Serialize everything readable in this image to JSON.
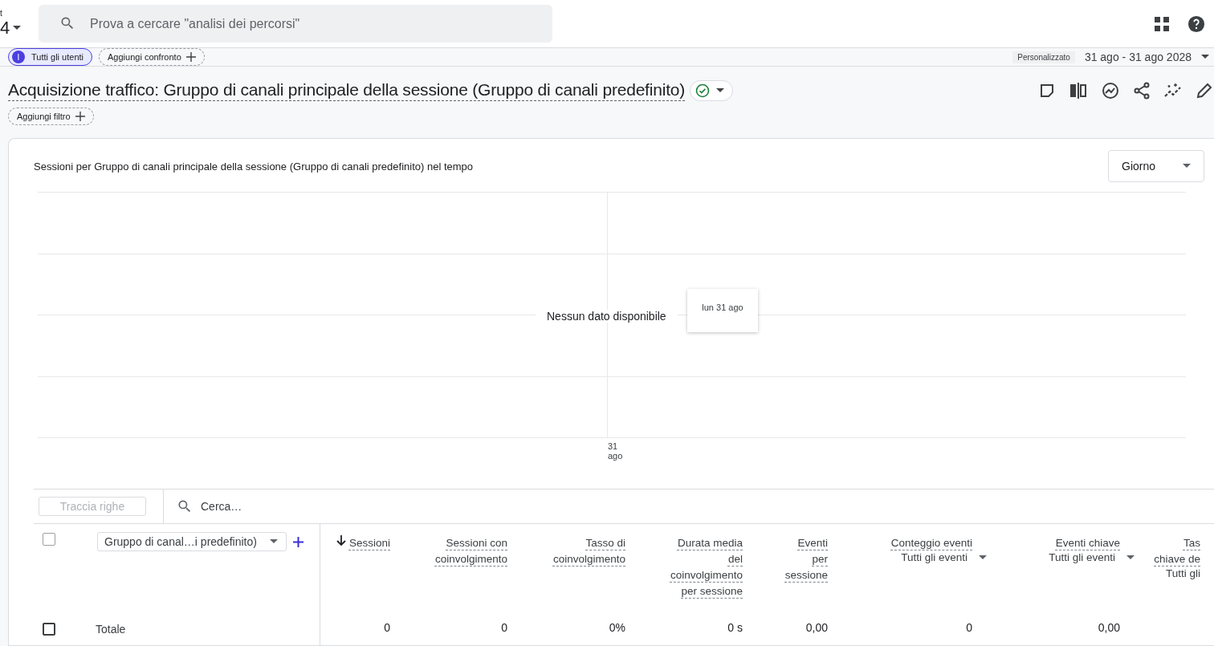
{
  "header": {
    "property_fragment": "t",
    "property_value": "4",
    "search": {
      "placeholder": "Prova a cercare \"analisi dei percorsi\""
    }
  },
  "comparisons": {
    "segment": {
      "letter": "I",
      "label": "Tutti gli utenti",
      "selected": true
    },
    "add_button": "Aggiungi confronto",
    "date_kind": "Personalizzato",
    "date_range": "31 ago - 31 ago 2028"
  },
  "report": {
    "title": "Acquisizione traffico: Gruppo di canali principale della sessione (Gruppo di canali predefinito)",
    "status_ok": true,
    "add_filter": "Aggiungi filtro"
  },
  "chart": {
    "title": "Sessioni per Gruppo di canali principale della sessione (Gruppo di canali predefinito) nel tempo",
    "granularity": "Giorno",
    "empty_message": "Nessun dato disponibile",
    "tooltip": "lun 31 ago",
    "x_label_day": "31",
    "x_label_month": "ago"
  },
  "table": {
    "plot_rows_button": "Traccia righe",
    "search": {
      "placeholder": "Cerca…"
    },
    "select_all_checked": false,
    "dimension": "Gruppo di canal…i predefinito)",
    "columns": [
      {
        "label": "Sessioni",
        "sorted": true
      },
      {
        "label": "Sessioni con coinvolgimento",
        "sorted": false
      },
      {
        "label": "Tasso di coinvolgimento",
        "sorted": false
      },
      {
        "label": "Durata media del coinvolgimento per sessione",
        "sorted": false
      },
      {
        "label": "Eventi per sessione",
        "sorted": false
      },
      {
        "label": "Conteggio eventi",
        "sorted": false,
        "filter": "Tutti gli eventi"
      },
      {
        "label": "Eventi chiave",
        "sorted": false,
        "filter": "Tutti gli eventi"
      },
      {
        "label": "Tas chiave de",
        "sorted": false,
        "filter": "Tutti gli"
      }
    ],
    "total": {
      "checked": false,
      "label": "Totale",
      "values": [
        "0",
        "0",
        "0%",
        "0 s",
        "0,00",
        "0",
        "0,00"
      ]
    }
  }
}
